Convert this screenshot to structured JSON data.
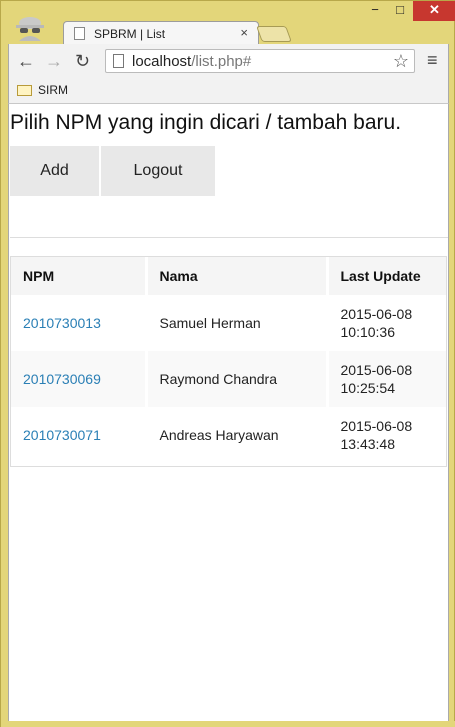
{
  "browser": {
    "tab_title": "SPBRM | List",
    "tab_close": "×",
    "url_host": "localhost",
    "url_path": "/list.php#",
    "bookmark": "SIRM",
    "window_controls": {
      "minimize": "−",
      "maximize": "□",
      "close": "✕"
    }
  },
  "page": {
    "heading": "Pilih NPM yang ingin dicari / tambah baru.",
    "add_label": "Add",
    "logout_label": "Logout"
  },
  "table": {
    "headers": {
      "npm": "NPM",
      "nama": "Nama",
      "last_update": "Last Update"
    },
    "rows": [
      {
        "npm": "2010730013",
        "nama": "Samuel Herman",
        "date": "2015-06-08",
        "time": "10:10:36"
      },
      {
        "npm": "2010730069",
        "nama": "Raymond Chandra",
        "date": "2015-06-08",
        "time": "10:25:54"
      },
      {
        "npm": "2010730071",
        "nama": "Andreas Haryawan",
        "date": "2015-06-08",
        "time": "13:43:48"
      }
    ]
  }
}
